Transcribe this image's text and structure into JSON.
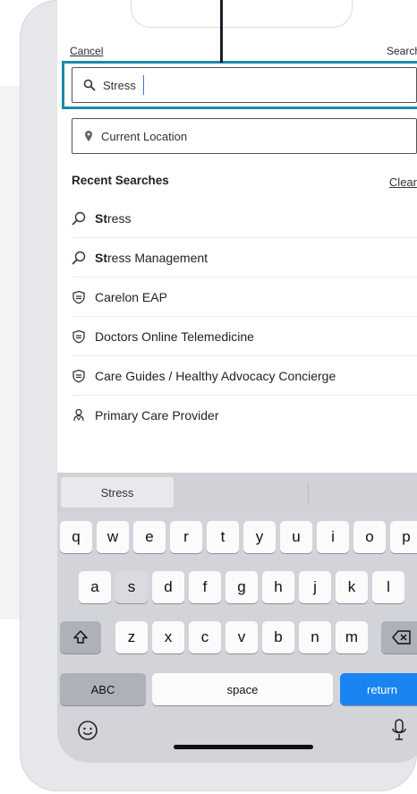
{
  "header": {
    "cancel_label": "Cancel",
    "search_label": "Search"
  },
  "search": {
    "value": "Stress",
    "icon": "search-icon"
  },
  "location": {
    "value": "Current Location",
    "icon": "location-pin-icon"
  },
  "recent": {
    "title": "Recent Searches",
    "clear_label": "Clear",
    "items": [
      {
        "icon": "search-icon",
        "bold": "St",
        "text": "ress"
      },
      {
        "icon": "search-icon",
        "bold": "St",
        "text": "ress Management"
      },
      {
        "icon": "shield-icon",
        "bold": "",
        "text": "Carelon EAP"
      },
      {
        "icon": "shield-icon",
        "bold": "",
        "text": "Doctors Online Telemedicine"
      },
      {
        "icon": "shield-icon",
        "bold": "",
        "text": "Care Guides / Healthy Advocacy Concierge"
      },
      {
        "icon": "person-badge-icon",
        "bold": "",
        "text": "Primary Care Provider"
      }
    ]
  },
  "keyboard": {
    "prediction": "Stress",
    "row1": [
      "q",
      "w",
      "e",
      "r",
      "t",
      "y",
      "u",
      "i",
      "o",
      "p"
    ],
    "row2": [
      "a",
      "s",
      "d",
      "f",
      "g",
      "h",
      "j",
      "k",
      "l"
    ],
    "row3": [
      "z",
      "x",
      "c",
      "v",
      "b",
      "n",
      "m"
    ],
    "abc_label": "ABC",
    "space_label": "space",
    "return_label": "return",
    "accent_color": "#1a85f2"
  }
}
